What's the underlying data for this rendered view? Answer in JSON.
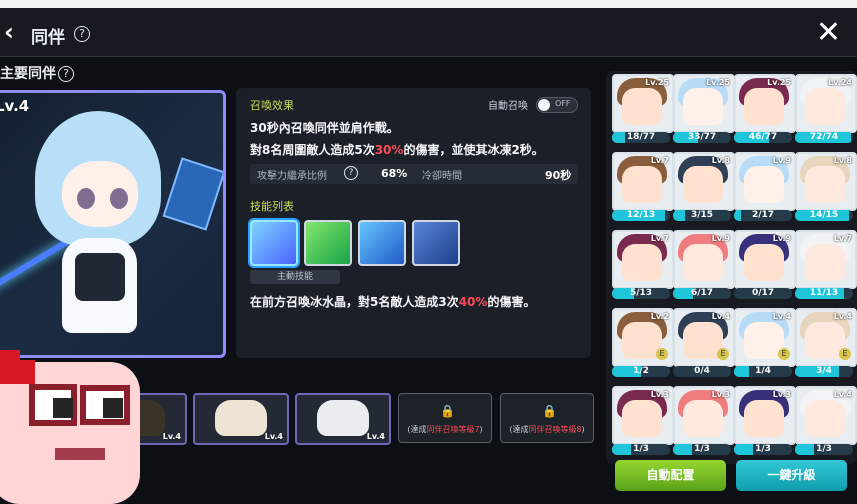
{
  "header": {
    "back_icon": "chevron-left-icon",
    "title": "同伴",
    "help": "?",
    "close": "✕"
  },
  "main_companion": {
    "label": "主要同伴",
    "help": "?",
    "level": "Lv.4"
  },
  "summon_effect": {
    "title": "召喚效果",
    "auto_summon_label": "自動召喚",
    "toggle_state": "OFF",
    "line1": "30秒內召喚同伴並肩作戰。",
    "line2_prefix": "對8名周圍敵人造成5次",
    "line2_percent": "30%",
    "line2_suffix": "的傷害，並使其冰凍2秒。",
    "inherit_label": "攻擊力繼承比例",
    "inherit_help": "?",
    "inherit_value": "68%",
    "cooldown_label": "冷卻時間",
    "cooldown_value": "90秒"
  },
  "skills": {
    "title": "技能列表",
    "active_label": "主動技能",
    "description_prefix": "在前方召喚冰水晶，對5名敵人造成3次",
    "description_percent": "40%",
    "description_suffix": "的傷害。",
    "icons": [
      "ice-crystal-skill-icon",
      "tree-skill-icon",
      "spin-skill-icon",
      "shield-skill-icon"
    ]
  },
  "slots": {
    "levels": [
      "Lv.4",
      "Lv.4",
      "Lv.4"
    ],
    "locked": [
      {
        "prefix": "(達成",
        "highlight": "同伴召喚等級7",
        "suffix": ")"
      },
      {
        "prefix": "(達成",
        "highlight": "同伴召喚等級8",
        "suffix": ")"
      }
    ]
  },
  "companions": [
    {
      "level": "Lv.25",
      "progress": "18/77",
      "fill": 0.23,
      "hair": "#8a5d3d",
      "face": "#ffe1cf",
      "e": false
    },
    {
      "level": "Lv.25",
      "progress": "33/77",
      "fill": 0.43,
      "hair": "#b8dcf6",
      "face": "#fff0ea",
      "e": false
    },
    {
      "level": "Lv.25",
      "progress": "46/77",
      "fill": 0.6,
      "hair": "#7b2a4f",
      "face": "#ffe1cf",
      "e": false
    },
    {
      "level": "Lv.24",
      "progress": "72/74",
      "fill": 0.97,
      "hair": "#eef3f6",
      "face": "#ffe8de",
      "e": false
    },
    {
      "level": "Lv.7",
      "progress": "12/13",
      "fill": 0.92,
      "hair": "#8a5d3d",
      "face": "#ffe1cf",
      "e": false
    },
    {
      "level": "Lv.8",
      "progress": "3/15",
      "fill": 0.2,
      "hair": "#2f3f55",
      "face": "#ffe1cf",
      "e": false
    },
    {
      "level": "Lv.9",
      "progress": "2/17",
      "fill": 0.12,
      "hair": "#b8dcf6",
      "face": "#fff0ea",
      "e": false
    },
    {
      "level": "Lv.8",
      "progress": "14/15",
      "fill": 0.93,
      "hair": "#e8d5bd",
      "face": "#ffe8de",
      "e": false
    },
    {
      "level": "Lv.7",
      "progress": "5/13",
      "fill": 0.38,
      "hair": "#7b2a4f",
      "face": "#ffe1cf",
      "e": false
    },
    {
      "level": "Lv.9",
      "progress": "6/17",
      "fill": 0.35,
      "hair": "#ef7c7e",
      "face": "#ffe8de",
      "e": false
    },
    {
      "level": "Lv.9",
      "progress": "0/17",
      "fill": 0.0,
      "hair": "#37307a",
      "face": "#ffe1cf",
      "e": false
    },
    {
      "level": "Lv.7",
      "progress": "11/13",
      "fill": 0.85,
      "hair": "#f2f3f4",
      "face": "#ffe8de",
      "e": false
    },
    {
      "level": "Lv.2",
      "progress": "1/2",
      "fill": 0.5,
      "hair": "#8a5d3d",
      "face": "#ffe1cf",
      "e": true
    },
    {
      "level": "Lv.4",
      "progress": "0/4",
      "fill": 0.0,
      "hair": "#2f3f55",
      "face": "#ffe1cf",
      "e": true
    },
    {
      "level": "Lv.4",
      "progress": "1/4",
      "fill": 0.25,
      "hair": "#b8dcf6",
      "face": "#fff0ea",
      "e": true
    },
    {
      "level": "Lv.4",
      "progress": "3/4",
      "fill": 0.75,
      "hair": "#e8d5bd",
      "face": "#ffe8de",
      "e": true
    },
    {
      "level": "Lv.3",
      "progress": "1/3",
      "fill": 0.33,
      "hair": "#7b2a4f",
      "face": "#ffe1cf",
      "e": false
    },
    {
      "level": "Lv.3",
      "progress": "1/3",
      "fill": 0.33,
      "hair": "#ef7c7e",
      "face": "#ffe8de",
      "e": false
    },
    {
      "level": "Lv.3",
      "progress": "1/3",
      "fill": 0.33,
      "hair": "#37307a",
      "face": "#ffe1cf",
      "e": false
    },
    {
      "level": "Lv.4",
      "progress": "1/3",
      "fill": 0.33,
      "hair": "#f2f3f4",
      "face": "#ffe8de",
      "e": false
    }
  ],
  "buttons": {
    "auto_arrange": "自動配置",
    "one_click_upgrade": "一鍵升級"
  }
}
